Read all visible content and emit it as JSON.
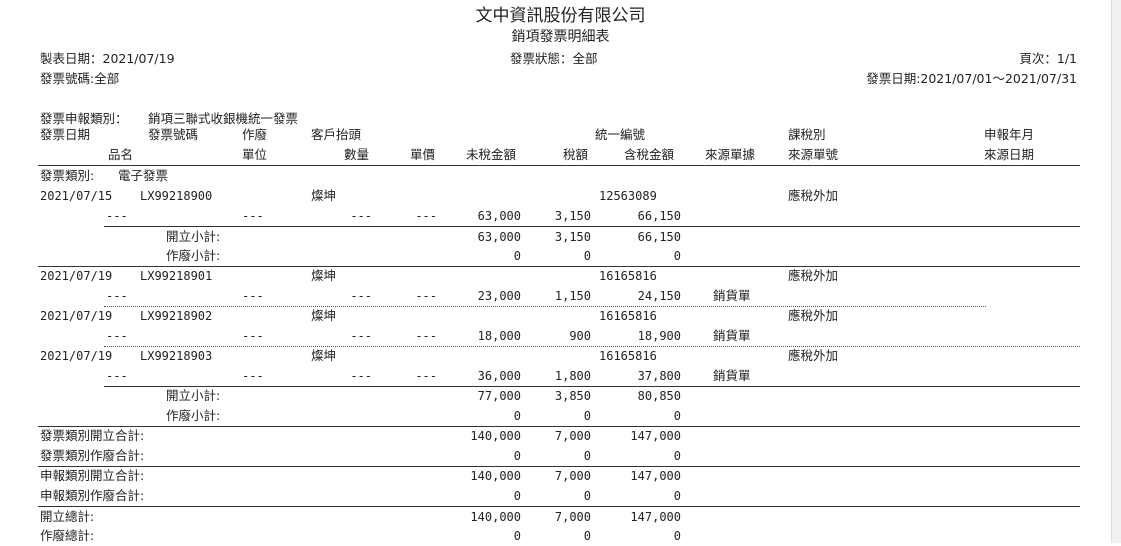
{
  "header": {
    "company": "文中資訊股份有限公司",
    "report_title": "銷項發票明細表",
    "made_date": "製表日期：2021/07/19",
    "invoice_status": "發票狀態：全部",
    "page": "頁次：1/1",
    "invoice_no_filter": "發票號碼:全部",
    "invoice_date_range": "發票日期:2021/07/01～2021/07/31",
    "declare_type": "發票申報類別：",
    "declare_type_value": "銷項三聯式收銀機統一發票"
  },
  "columns_row1": {
    "invoice_date": "發票日期",
    "invoice_no": "發票號碼",
    "void": "作廢",
    "customer": "客戶抬頭",
    "tax_id": "統一編號",
    "tax_type": "課稅別",
    "declare_month": "申報年月"
  },
  "columns_row2": {
    "item_name": "品名",
    "unit": "單位",
    "qty": "數量",
    "price": "單價",
    "untaxed": "未稅金額",
    "tax": "稅額",
    "total": "含稅金額",
    "source_doc": "來源單據",
    "source_no": "來源單號",
    "source_date": "來源日期"
  },
  "group": {
    "label": "發票類別:",
    "value": "電子發票"
  },
  "invoices": [
    {
      "date": "2021/07/15",
      "no": "LX99218900",
      "customer": "燦坤",
      "tax_id": "12563089",
      "tax_type": "應稅外加",
      "item": "---",
      "unit": "---",
      "qty": "---",
      "price": "---",
      "untaxed": "63,000",
      "tax": "3,150",
      "total": "66,150",
      "source": ""
    },
    {
      "date": "2021/07/19",
      "no": "LX99218901",
      "customer": "燦坤",
      "tax_id": "16165816",
      "tax_type": "應稅外加",
      "item": "---",
      "unit": "---",
      "qty": "---",
      "price": "---",
      "untaxed": "23,000",
      "tax": "1,150",
      "total": "24,150",
      "source": "銷貨單"
    },
    {
      "date": "2021/07/19",
      "no": "LX99218902",
      "customer": "燦坤",
      "tax_id": "16165816",
      "tax_type": "應稅外加",
      "item": "---",
      "unit": "---",
      "qty": "---",
      "price": "---",
      "untaxed": "18,000",
      "tax": "900",
      "total": "18,900",
      "source": "銷貨單"
    },
    {
      "date": "2021/07/19",
      "no": "LX99218903",
      "customer": "燦坤",
      "tax_id": "16165816",
      "tax_type": "應稅外加",
      "item": "---",
      "unit": "---",
      "qty": "---",
      "price": "---",
      "untaxed": "36,000",
      "tax": "1,800",
      "total": "37,800",
      "source": "銷貨單"
    }
  ],
  "subtotals": [
    {
      "open_label": "開立小計:",
      "open_untaxed": "63,000",
      "open_tax": "3,150",
      "open_total": "66,150",
      "void_label": "作廢小計:",
      "void_untaxed": "0",
      "void_tax": "0",
      "void_total": "0"
    },
    {
      "open_label": "開立小計:",
      "open_untaxed": "77,000",
      "open_tax": "3,850",
      "open_total": "80,850",
      "void_label": "作廢小計:",
      "void_untaxed": "0",
      "void_tax": "0",
      "void_total": "0"
    }
  ],
  "totals": [
    {
      "label": "發票類別開立合計:",
      "untaxed": "140,000",
      "tax": "7,000",
      "total": "147,000"
    },
    {
      "label": "發票類別作廢合計:",
      "untaxed": "0",
      "tax": "0",
      "total": "0"
    },
    {
      "label": "申報類別開立合計:",
      "untaxed": "140,000",
      "tax": "7,000",
      "total": "147,000"
    },
    {
      "label": "申報類別作廢合計:",
      "untaxed": "0",
      "tax": "0",
      "total": "0"
    },
    {
      "label": "開立總計:",
      "untaxed": "140,000",
      "tax": "7,000",
      "total": "147,000"
    },
    {
      "label": "作廢總計:",
      "untaxed": "0",
      "tax": "0",
      "total": "0"
    }
  ]
}
